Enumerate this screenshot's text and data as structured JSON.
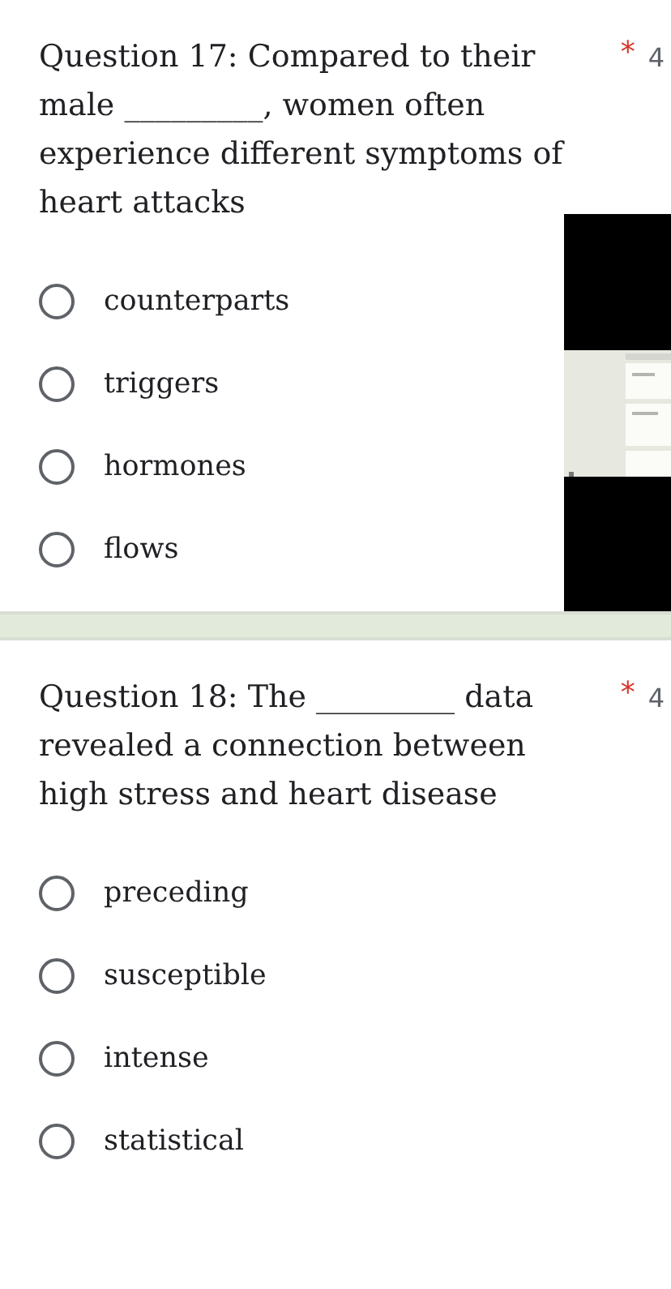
{
  "questions": [
    {
      "title": "Question 17: Compared to their male _________, women often experience different symptoms of heart attacks",
      "required_mark": "*",
      "points": "4",
      "options": [
        {
          "label": "counterparts",
          "selected": false
        },
        {
          "label": "triggers",
          "selected": false
        },
        {
          "label": "hormones",
          "selected": false
        },
        {
          "label": "flows",
          "selected": false
        }
      ]
    },
    {
      "title": "Question 18: The _________ data revealed a connection between high stress and heart disease",
      "required_mark": "*",
      "points": "4",
      "options": [
        {
          "label": "preceding",
          "selected": false
        },
        {
          "label": "susceptible",
          "selected": false
        },
        {
          "label": "intense",
          "selected": false
        },
        {
          "label": "statistical",
          "selected": false
        }
      ]
    }
  ]
}
